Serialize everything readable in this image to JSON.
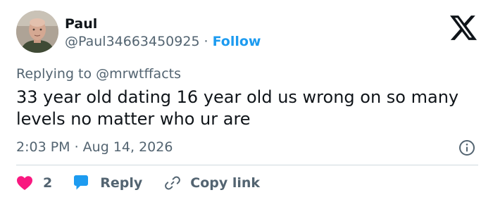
{
  "author": {
    "name": "Paul",
    "handle": "@Paul34663450925",
    "separator": "·",
    "follow_label": "Follow"
  },
  "reply_context": {
    "prefix": "Replying to ",
    "mention": "@mrwtffacts"
  },
  "tweet": {
    "text": "33 year old dating 16 year old us wrong on so many levels no matter who ur are",
    "timestamp": "2:03 PM · Aug 14, 2026"
  },
  "actions": {
    "like_count": "2",
    "reply_label": "Reply",
    "copy_link_label": "Copy link"
  },
  "icons": {
    "logo": "x-logo-icon",
    "info": "info-icon",
    "like": "heart-icon",
    "reply": "speech-bubble-icon",
    "copy_link": "link-icon"
  },
  "colors": {
    "accent": "#1d9bf0",
    "like": "#f91880",
    "text": "#0f1419",
    "secondary": "#536471",
    "divider": "#cfd9de"
  }
}
